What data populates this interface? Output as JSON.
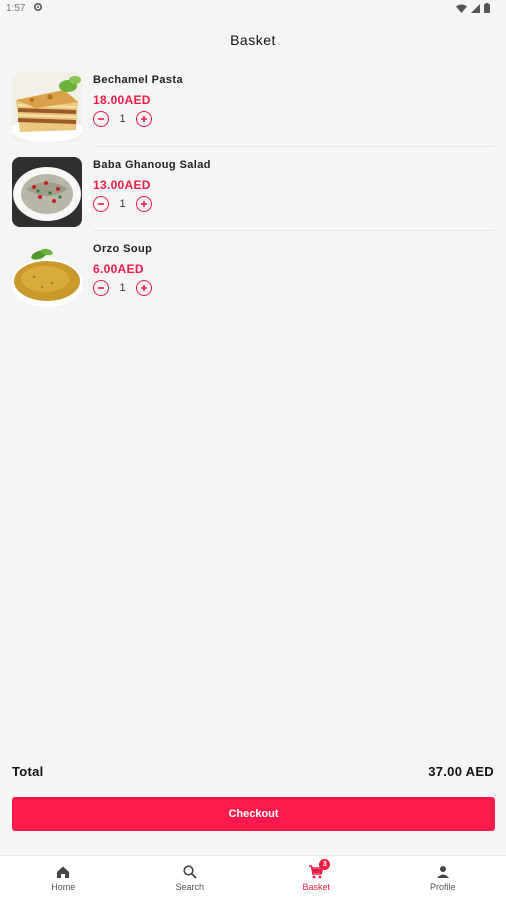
{
  "status_bar": {
    "time": "1:57",
    "icons": [
      "gear-icon",
      "wifi-icon",
      "signal-icon",
      "battery-icon"
    ]
  },
  "header": {
    "title": "Basket"
  },
  "basket": {
    "items": [
      {
        "name": "Bechamel Pasta",
        "price": "18.00AED",
        "quantity": "1"
      },
      {
        "name": "Baba Ghanoug Salad",
        "price": "13.00AED",
        "quantity": "1"
      },
      {
        "name": "Orzo Soup",
        "price": "6.00AED",
        "quantity": "1"
      }
    ]
  },
  "summary": {
    "total_label": "Total",
    "total_value": "37.00 AED"
  },
  "checkout": {
    "label": "Checkout"
  },
  "nav": {
    "items": [
      {
        "label": "Home",
        "icon": "home-icon"
      },
      {
        "label": "Search",
        "icon": "search-icon"
      },
      {
        "label": "Basket",
        "icon": "cart-icon",
        "badge": "3",
        "active": true
      },
      {
        "label": "Profile",
        "icon": "person-icon"
      }
    ]
  },
  "colors": {
    "accent": "#ee1c47",
    "button": "#ff1a4b",
    "background": "#f5f5f5"
  }
}
